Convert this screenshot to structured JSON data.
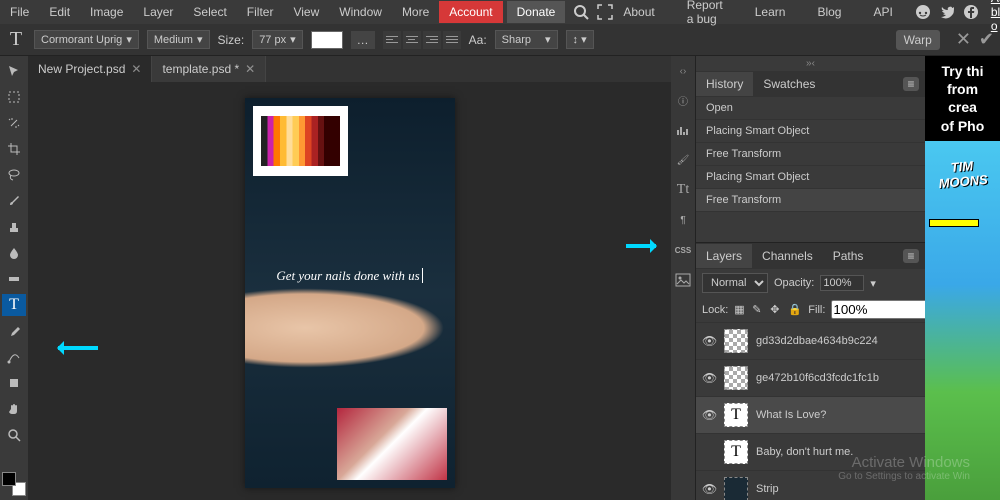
{
  "menubar": {
    "items": [
      "File",
      "Edit",
      "Image",
      "Layer",
      "Select",
      "Filter",
      "View",
      "Window",
      "More"
    ],
    "account": "Account",
    "donate": "Donate",
    "right": [
      "About",
      "Report a bug",
      "Learn",
      "Blog",
      "API"
    ],
    "ad_link": "Ad blocking o"
  },
  "optbar": {
    "font": "Cormorant Uprig",
    "weight": "Medium",
    "size_label": "Size:",
    "size": "77 px",
    "aa_label": "Aa:",
    "aa": "Sharp",
    "warp": "Warp"
  },
  "tabs": [
    {
      "label": "New Project.psd",
      "dirty": false
    },
    {
      "label": "template.psd *",
      "dirty": true
    }
  ],
  "canvas": {
    "text": "Get your nails done with us"
  },
  "panels": {
    "history_tabs": [
      "History",
      "Swatches"
    ],
    "history": [
      "Open",
      "Placing Smart Object",
      "Free Transform",
      "Placing Smart Object",
      "Free Transform"
    ],
    "layers_tabs": [
      "Layers",
      "Channels",
      "Paths"
    ],
    "blend": "Normal",
    "opacity_label": "Opacity:",
    "opacity": "100%",
    "lock_label": "Lock:",
    "fill_label": "Fill:",
    "fill": "100%",
    "layers": [
      {
        "name": "gd33d2dbae4634b9c224",
        "type": "checker"
      },
      {
        "name": "ge472b10f6cd3fcdc1fc1b",
        "type": "checker"
      },
      {
        "name": "What Is Love?",
        "type": "text",
        "active": true
      },
      {
        "name": "Baby, don't hurt me.",
        "type": "text"
      },
      {
        "name": "Strip",
        "type": "dark"
      }
    ]
  },
  "ad": {
    "lines": [
      "Try thi",
      "from",
      "crea",
      "of Pho"
    ],
    "game_title": "TIM\nMOONS"
  },
  "watermark": {
    "title": "Activate Windows",
    "sub": "Go to Settings to activate Win"
  }
}
